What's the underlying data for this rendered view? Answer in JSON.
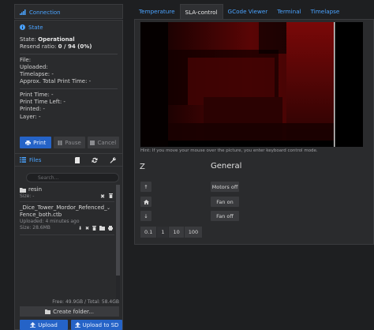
{
  "connection": {
    "title": "Connection",
    "icon": "signal-bars-icon"
  },
  "state": {
    "title": "State",
    "icon": "info-circle-icon",
    "state_label": "State:",
    "state_value": "Operational",
    "resend_label": "Resend ratio:",
    "resend_value": "0 / 94 (0%)",
    "file_line": "File:",
    "uploaded_line": "Uploaded:",
    "timelapse_line": "Timelapse: -",
    "approx_line": "Approx. Total Print Time: -",
    "print_time_line": "Print Time: -",
    "print_left_line": "Print Time Left: -",
    "printed_line": "Printed: -",
    "layer_line": "Layer: -",
    "buttons": {
      "print": "Print",
      "pause": "Pause",
      "cancel": "Cancel"
    }
  },
  "files": {
    "title": "Files",
    "search_placeholder": "Search...",
    "folder": {
      "name": "resin",
      "size": "Size: -"
    },
    "file": {
      "name_line1": "_Dice_Tower_Mordor_Refenced_",
      "name_line2": "Fence_both.ctb",
      "uploaded": "Uploaded: 4 minutes ago",
      "size": "Size: 28.6MB"
    },
    "free_space": "Free: 49.9GB / Total: 58.4GB",
    "create_folder": "Create folder...",
    "upload": "Upload",
    "upload_sd": "Upload to SD"
  },
  "tabs": [
    "Temperature",
    "SLA-control",
    "GCode Viewer",
    "Terminal",
    "Timelapse"
  ],
  "active_tab": "SLA-control",
  "control": {
    "hint": "Hint: If you move your mouse over the picture, you enter keyboard control mode.",
    "z_label": "Z",
    "general_label": "General",
    "motors_off": "Motors off",
    "fan_on": "Fan on",
    "fan_off": "Fan off",
    "steps": [
      "0.1",
      "1",
      "10",
      "100"
    ]
  },
  "colors": {
    "accent": "#4aa3ff",
    "primary_button": "#2563c7",
    "panel": "#2a2b2d",
    "background": "#1e1f21"
  }
}
